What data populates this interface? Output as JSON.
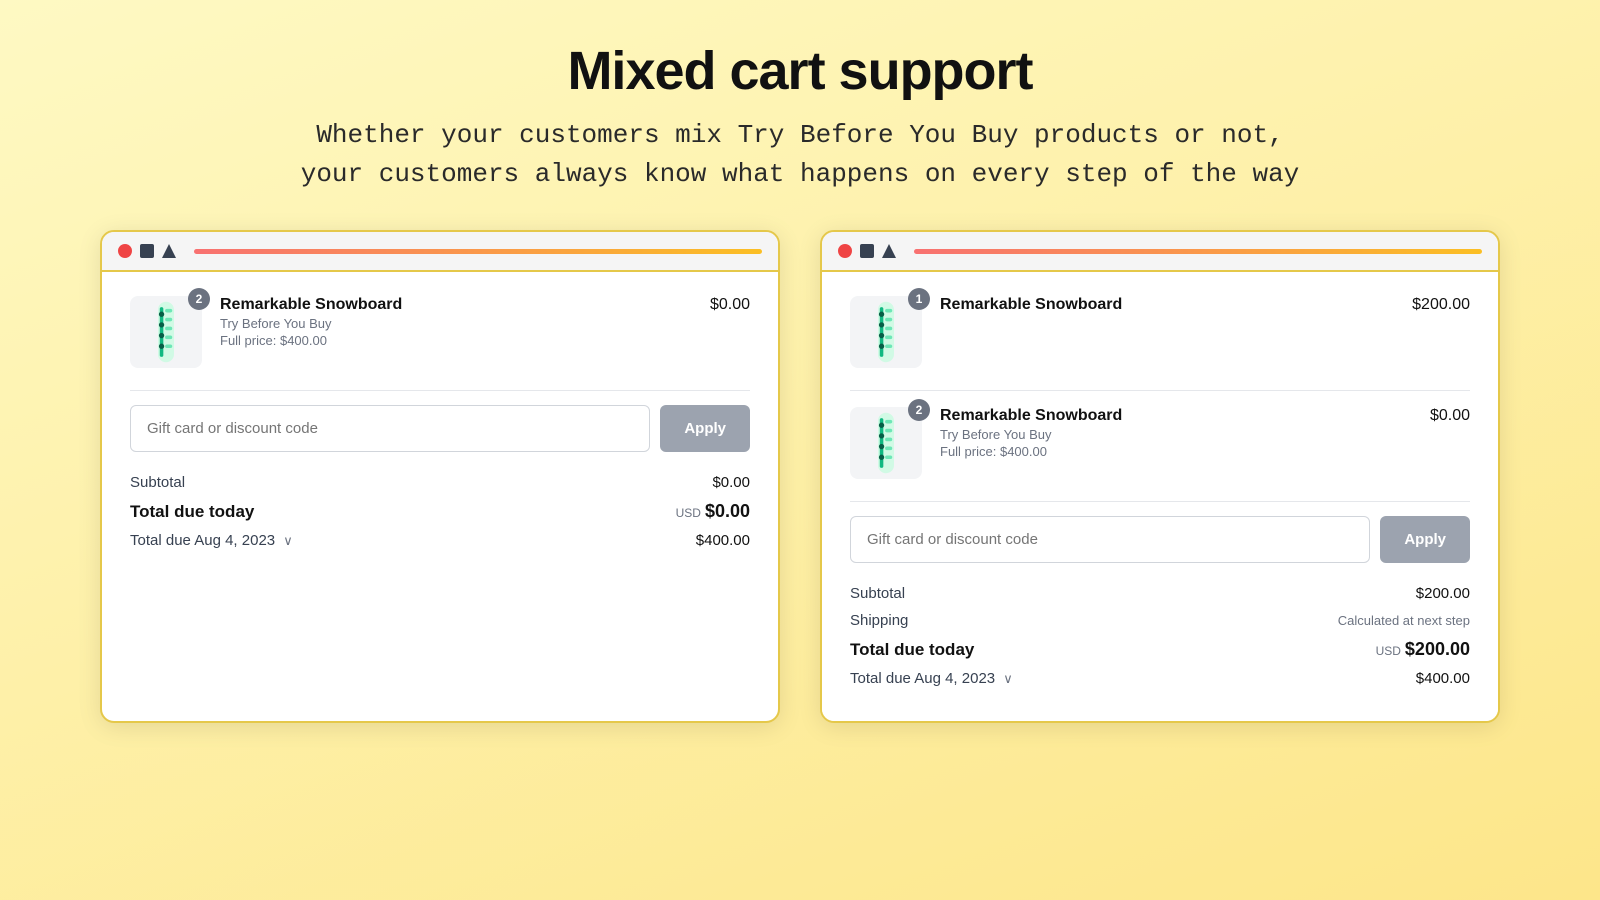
{
  "header": {
    "title": "Mixed cart support",
    "subtitle_line1": "Whether your customers mix Try Before You Buy products or not,",
    "subtitle_line2": "your customers always know what happens on every step of the way"
  },
  "panel_left": {
    "product": {
      "badge": "2",
      "name": "Remarkable Snowboard",
      "tag": "Try Before You Buy",
      "full_price": "Full price: $400.00",
      "price": "$0.00"
    },
    "discount_placeholder": "Gift card or discount code",
    "apply_label": "Apply",
    "subtotal_label": "Subtotal",
    "subtotal_value": "$0.00",
    "total_today_label": "Total due today",
    "total_today_usd": "USD",
    "total_today_value": "$0.00",
    "total_later_label": "Total due Aug 4, 2023",
    "total_later_value": "$400.00"
  },
  "panel_right": {
    "product1": {
      "badge": "1",
      "name": "Remarkable Snowboard",
      "tag": null,
      "full_price": null,
      "price": "$200.00"
    },
    "product2": {
      "badge": "2",
      "name": "Remarkable Snowboard",
      "tag": "Try Before You Buy",
      "full_price": "Full price: $400.00",
      "price": "$0.00"
    },
    "discount_placeholder": "Gift card or discount code",
    "apply_label": "Apply",
    "subtotal_label": "Subtotal",
    "subtotal_value": "$200.00",
    "shipping_label": "Shipping",
    "shipping_value": "Calculated at next step",
    "total_today_label": "Total due today",
    "total_today_usd": "USD",
    "total_today_value": "$200.00",
    "total_later_label": "Total due Aug 4, 2023",
    "total_later_value": "$400.00"
  }
}
